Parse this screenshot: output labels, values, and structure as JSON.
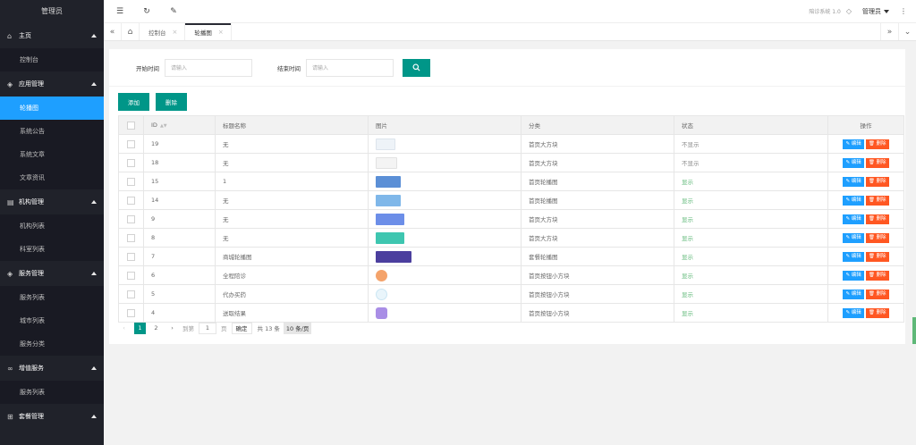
{
  "sidebar": {
    "title": "管理员",
    "groups": [
      {
        "label": "主页",
        "icon": "home-icon",
        "items": [
          {
            "label": "控制台"
          }
        ]
      },
      {
        "label": "应用管理",
        "icon": "layers-icon",
        "items": [
          {
            "label": "轮播图",
            "active": true
          },
          {
            "label": "系统公告"
          },
          {
            "label": "系统文章"
          },
          {
            "label": "文章资讯"
          }
        ]
      },
      {
        "label": "机构管理",
        "icon": "list-icon",
        "items": [
          {
            "label": "机构列表"
          },
          {
            "label": "科室列表"
          }
        ]
      },
      {
        "label": "服务管理",
        "icon": "layers-icon",
        "items": [
          {
            "label": "服务列表"
          },
          {
            "label": "城市列表"
          },
          {
            "label": "服务分类"
          }
        ]
      },
      {
        "label": "增值服务",
        "icon": "link-icon",
        "items": [
          {
            "label": "服务列表"
          }
        ]
      },
      {
        "label": "套餐管理",
        "icon": "cart-icon",
        "items": []
      }
    ]
  },
  "header": {
    "system_name": "陪诊系统 1.0",
    "user": "管理员"
  },
  "tabs": [
    {
      "label": "控制台"
    },
    {
      "label": "轮播图",
      "active": true
    }
  ],
  "filter": {
    "start_label": "开始时间",
    "start_placeholder": "请输入",
    "end_label": "结束时间",
    "end_placeholder": "请输入"
  },
  "toolbar": {
    "add_label": "添加",
    "delete_label": "删除"
  },
  "table": {
    "headers": [
      "ID",
      "标题名称",
      "图片",
      "分类",
      "状态",
      "操作"
    ],
    "edit_label": "编辑",
    "delete_label": "删除",
    "rows": [
      {
        "id": "19",
        "title": "无",
        "thumb": "th-a",
        "category": "首页大方块",
        "status": "不显示",
        "shown": false
      },
      {
        "id": "18",
        "title": "无",
        "thumb": "th-b",
        "category": "首页大方块",
        "status": "不显示",
        "shown": false
      },
      {
        "id": "15",
        "title": "1",
        "thumb": "th-c",
        "category": "首页轮播图",
        "status": "显示",
        "shown": true
      },
      {
        "id": "14",
        "title": "无",
        "thumb": "th-d",
        "category": "首页轮播图",
        "status": "显示",
        "shown": true
      },
      {
        "id": "9",
        "title": "无",
        "thumb": "th-e",
        "category": "首页大方块",
        "status": "显示",
        "shown": true
      },
      {
        "id": "8",
        "title": "无",
        "thumb": "th-f",
        "category": "首页大方块",
        "status": "显示",
        "shown": true
      },
      {
        "id": "7",
        "title": "商城轮播图",
        "thumb": "th-g",
        "category": "套餐轮播图",
        "status": "显示",
        "shown": true
      },
      {
        "id": "6",
        "title": "全程陪诊",
        "thumb": "th-h",
        "category": "首页按钮小方块",
        "status": "显示",
        "shown": true
      },
      {
        "id": "5",
        "title": "代办买药",
        "thumb": "th-i",
        "category": "首页按钮小方块",
        "status": "显示",
        "shown": true
      },
      {
        "id": "4",
        "title": "送取结果",
        "thumb": "th-j",
        "category": "首页按钮小方块",
        "status": "显示",
        "shown": true
      }
    ]
  },
  "pager": {
    "pages": [
      "1",
      "2"
    ],
    "goto_label": "到第",
    "goto_value": "1",
    "page_suffix": "页",
    "confirm_label": "确定",
    "total": "共 13 条",
    "page_size": "10 条/页"
  }
}
